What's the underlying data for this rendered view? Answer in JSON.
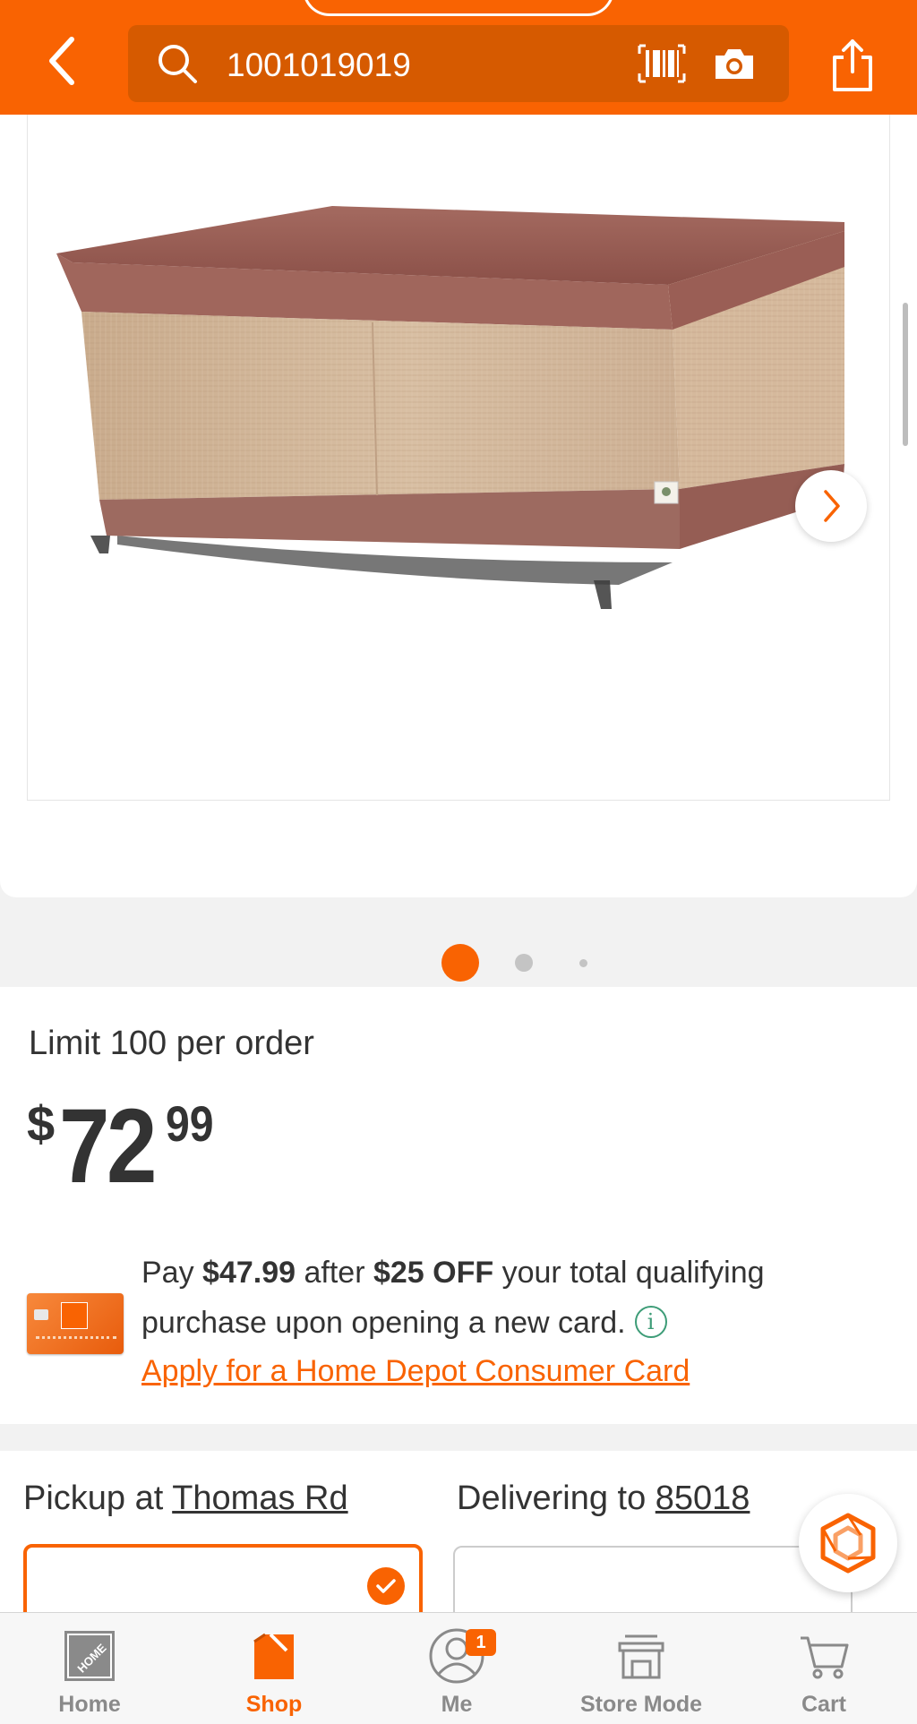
{
  "header": {
    "search_value": "1001019019",
    "icons": [
      "back-arrow-icon",
      "search-icon",
      "barcode-icon",
      "camera-icon",
      "share-icon"
    ]
  },
  "gallery": {
    "image_description_alt": "",
    "page_count": 3,
    "active_page": 1
  },
  "pricing": {
    "limit_text": "Limit 100 per order",
    "price_dollar_sign": "$",
    "price_whole": "72",
    "price_cents": "99",
    "promo_prefix": "Pay ",
    "promo_amount": "$47.99",
    "promo_middle": " after ",
    "promo_discount": "$25 OFF",
    "promo_suffix": " your total qualifying",
    "promo_line2": "purchase upon opening a new card.",
    "info_glyph": "i",
    "apply_link": "Apply for a Home Depot Consumer Card"
  },
  "fulfillment": {
    "pickup_prefix": "Pickup at ",
    "pickup_store": "Thomas Rd",
    "delivery_prefix": "Delivering to ",
    "delivery_zip": "85018"
  },
  "bottom_nav": {
    "items": [
      {
        "label": "Home",
        "active": false
      },
      {
        "label": "Shop",
        "active": true
      },
      {
        "label": "Me",
        "active": false,
        "badge": "1"
      },
      {
        "label": "Store Mode",
        "active": false
      },
      {
        "label": "Cart",
        "active": false
      }
    ]
  },
  "colors": {
    "brand_orange": "#f96302",
    "search_bg": "#d65a00",
    "info_green": "#3d9c77"
  }
}
